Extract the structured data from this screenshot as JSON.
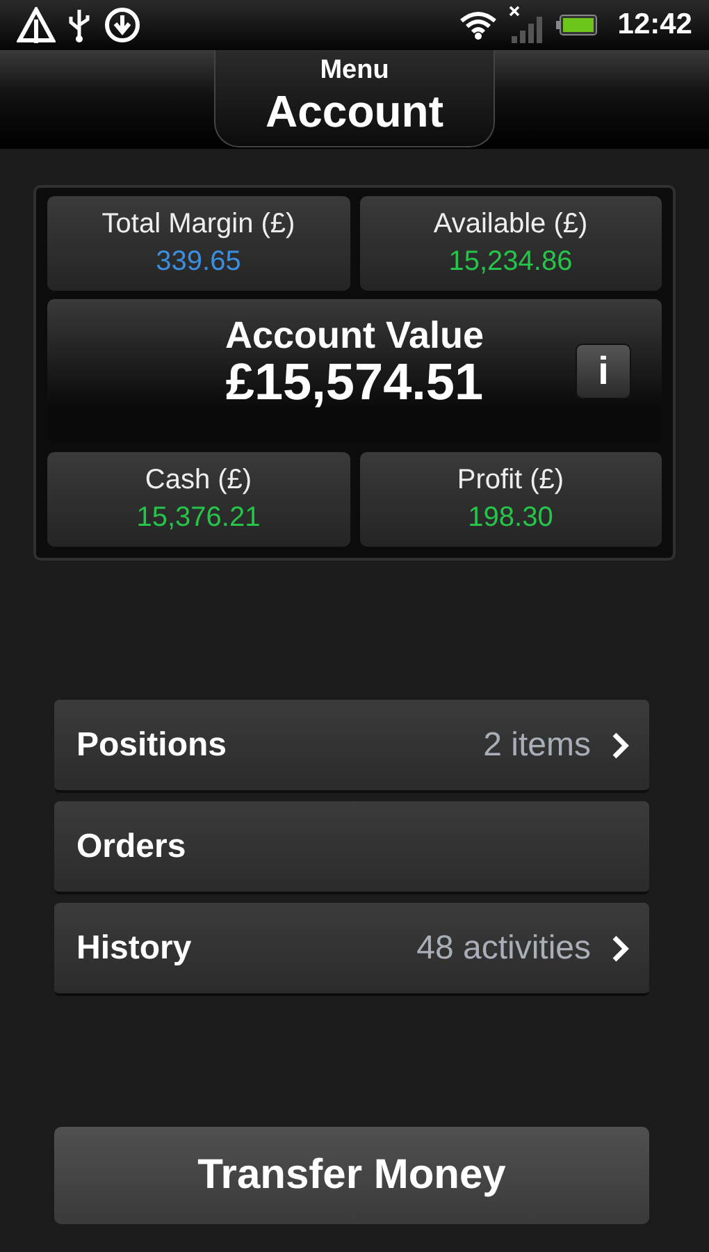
{
  "status_bar": {
    "time": "12:42"
  },
  "header": {
    "subtitle": "Menu",
    "title": "Account"
  },
  "summary": {
    "stats_top": [
      {
        "label": "Total Margin (£)",
        "value": "339.65",
        "color": "#3a8fe0"
      },
      {
        "label": "Available (£)",
        "value": "15,234.86",
        "color": "#27c44a"
      }
    ],
    "account_value": {
      "label": "Account Value",
      "value": "£15,574.51",
      "info_button": "i"
    },
    "stats_bottom": [
      {
        "label": "Cash (£)",
        "value": "15,376.21",
        "color": "#27c44a"
      },
      {
        "label": "Profit (£)",
        "value": "198.30",
        "color": "#27c44a"
      }
    ]
  },
  "menu": [
    {
      "label": "Positions",
      "detail": "2 items",
      "chevron": true
    },
    {
      "label": "Orders",
      "chevron": false
    },
    {
      "label": "History",
      "detail": "48 activities",
      "chevron": true
    }
  ],
  "transfer_button": "Transfer Money"
}
